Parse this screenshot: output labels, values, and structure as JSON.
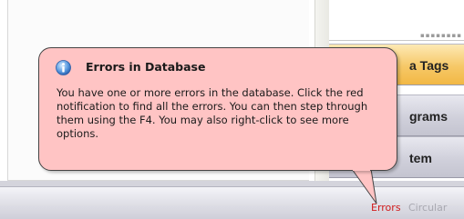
{
  "balloon": {
    "title": "Errors in Database",
    "body": "You have one or more errors in the database. Click the red notification to find all the errors. You can then step through them using the F4. You may also right-click to see more options.",
    "icon": "info-icon",
    "background": "#ffc4c4"
  },
  "nav": {
    "items": [
      {
        "label": "a Tags",
        "state": "active"
      },
      {
        "label": "grams",
        "state": "normal"
      },
      {
        "label": "tem",
        "state": "normal"
      }
    ]
  },
  "status": {
    "errors_label": "Errors",
    "circular_label": "Circular",
    "errors_color": "#d11a1a"
  }
}
